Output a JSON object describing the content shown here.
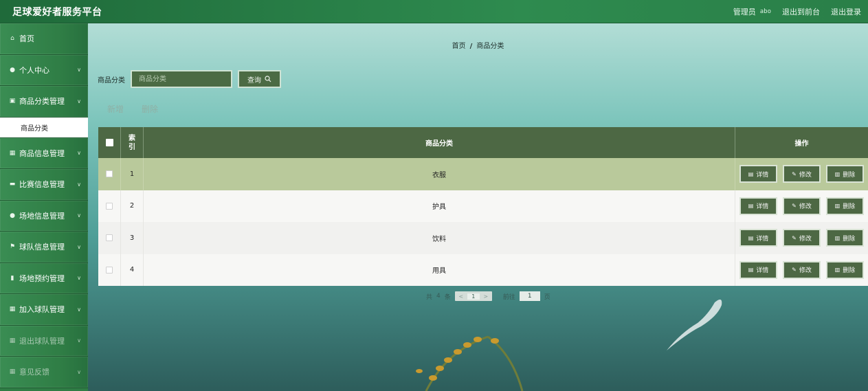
{
  "header": {
    "title": "足球爱好者服务平台",
    "role": "管理员",
    "username": "abo",
    "to_front": "退出到前台",
    "logout": "退出登录"
  },
  "sidebar": {
    "items": [
      {
        "label": "首页",
        "icon": "home-icon"
      },
      {
        "label": "个人中心",
        "icon": "user-icon"
      },
      {
        "label": "商品分类管理",
        "icon": "box-icon"
      },
      {
        "label": "商品信息管理",
        "icon": "grid-icon"
      },
      {
        "label": "比赛信息管理",
        "icon": "monitor-icon"
      },
      {
        "label": "场地信息管理",
        "icon": "user-icon"
      },
      {
        "label": "球队信息管理",
        "icon": "flag-icon"
      },
      {
        "label": "场地预约管理",
        "icon": "bar-chart-icon"
      },
      {
        "label": "加入球队管理",
        "icon": "grid-icon"
      },
      {
        "label": "退出球队管理",
        "icon": "grid-icon"
      },
      {
        "label": "意见反馈",
        "icon": "grid-icon"
      }
    ],
    "active_sub": "商品分类"
  },
  "breadcrumb": {
    "home": "首页",
    "sep": "/",
    "current": "商品分类"
  },
  "search": {
    "label": "商品分类",
    "placeholder": "商品分类",
    "button": "查询"
  },
  "actions": {
    "add": "新增",
    "delete": "删除"
  },
  "table": {
    "headers": {
      "index": "索引",
      "name": "商品分类",
      "ops": "操作"
    },
    "rows": [
      {
        "index": "1",
        "name": "衣服"
      },
      {
        "index": "2",
        "name": "护具"
      },
      {
        "index": "3",
        "name": "饮料"
      },
      {
        "index": "4",
        "name": "用具"
      }
    ],
    "buttons": {
      "detail": "详情",
      "edit": "修改",
      "delete": "删除"
    }
  },
  "pagination": {
    "total_prefix": "共",
    "total": "4",
    "total_suffix": "条",
    "prev": "<",
    "page": "1",
    "next": ">",
    "goto_prefix": "前往",
    "goto_value": "1",
    "goto_suffix": "页"
  },
  "colors": {
    "topbar": "#2e8b4f",
    "sidebar": "#2f7d45",
    "table_header": "#4d6844",
    "highlight_row": "#b9c99b",
    "button": "#4d6844"
  }
}
